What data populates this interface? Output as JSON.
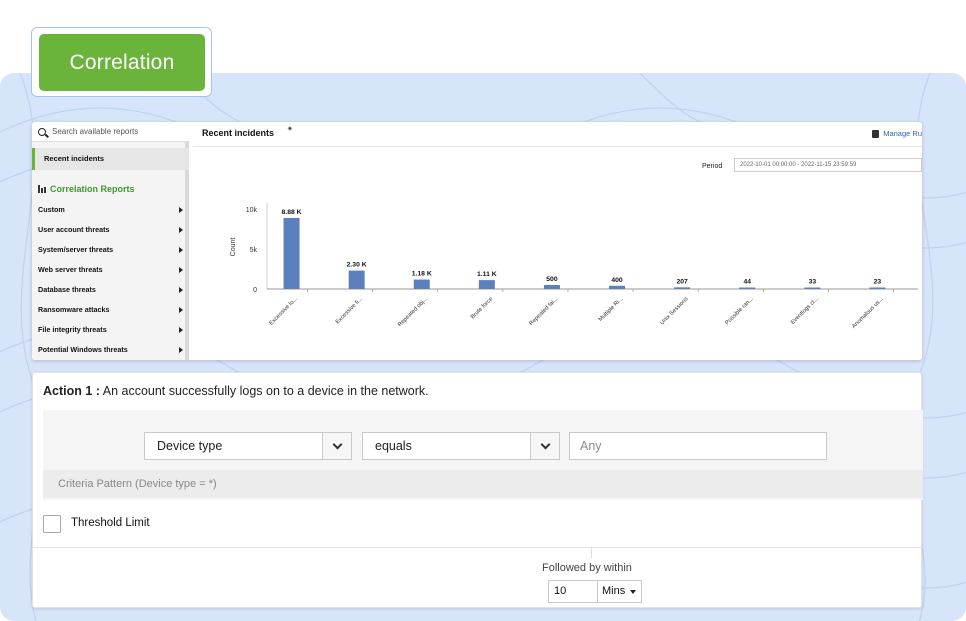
{
  "badge": {
    "label": "Correlation"
  },
  "app": {
    "search_placeholder": "Search available reports",
    "sidebar": {
      "selected_item": "Recent incidents",
      "section_title": "Correlation Reports",
      "items": [
        {
          "label": "Custom"
        },
        {
          "label": "User account threats"
        },
        {
          "label": "System/server threats"
        },
        {
          "label": "Web server threats"
        },
        {
          "label": "Database threats"
        },
        {
          "label": "Ransomware attacks"
        },
        {
          "label": "File integrity threats"
        },
        {
          "label": "Potential Windows threats"
        }
      ]
    },
    "main": {
      "title": "Recent incidents",
      "manage_label": "Manage Ru",
      "period_label": "Period",
      "period_value": "2022-10-01 00:00:00 - 2022-11-15 23:59:59"
    }
  },
  "chart_data": {
    "type": "bar",
    "ylabel": "Count",
    "ylim": [
      0,
      10000
    ],
    "yticks": [
      {
        "value": 0,
        "label": "0"
      },
      {
        "value": 5000,
        "label": "5k"
      },
      {
        "value": 10000,
        "label": "10k"
      }
    ],
    "grid": false,
    "categories": [
      "Excessive lo...",
      "Excessive fi...",
      "Repeated obj...",
      "Brute force",
      "Repeated fai...",
      "Multiple Ri...",
      "Unix Sessions",
      "Possible ran...",
      "Eventlogs cl...",
      "Anomalous us..."
    ],
    "values": [
      8880,
      2300,
      1180,
      1110,
      500,
      400,
      207,
      44,
      33,
      23
    ],
    "data_labels": [
      "8.88 K",
      "2.30 K",
      "1.18 K",
      "1.11 K",
      "500",
      "400",
      "207",
      "44",
      "33",
      "23"
    ],
    "bar_color": "#5b80bd"
  },
  "form": {
    "action_prefix": "Action 1 :",
    "action_text": " An account successfully logs on to a device in the network.",
    "field_select": "Device type",
    "operator_select": "equals",
    "value_placeholder": "Any",
    "criteria_pattern": "Criteria Pattern (Device type = *)",
    "threshold_label": "Threshold Limit",
    "threshold_checked": false,
    "followed_label": "Followed by within",
    "within_value": "10",
    "within_unit": "Mins"
  },
  "colors": {
    "accent_green": "#6bb43c",
    "background_blue": "#d7e5fb",
    "link_blue": "#2f63b5"
  }
}
